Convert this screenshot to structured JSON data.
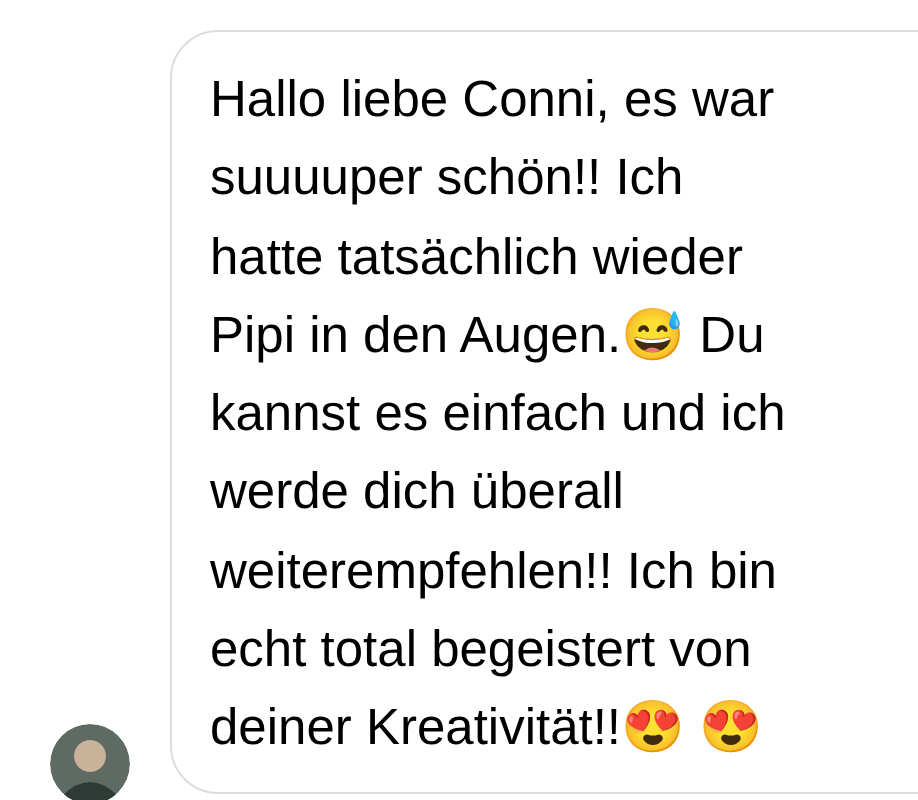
{
  "message": {
    "lines": [
      "Hallo liebe Conni, es war",
      "suuuuper schön!! Ich",
      "hatte tatsächlich wieder",
      "Pipi in den Augen.😅 Du",
      "kannst es einfach und ich",
      "werde dich überall",
      "weiterempfehlen!! Ich bin",
      "echt total begeistert von",
      "deiner Kreativität!!😍 😍"
    ]
  }
}
